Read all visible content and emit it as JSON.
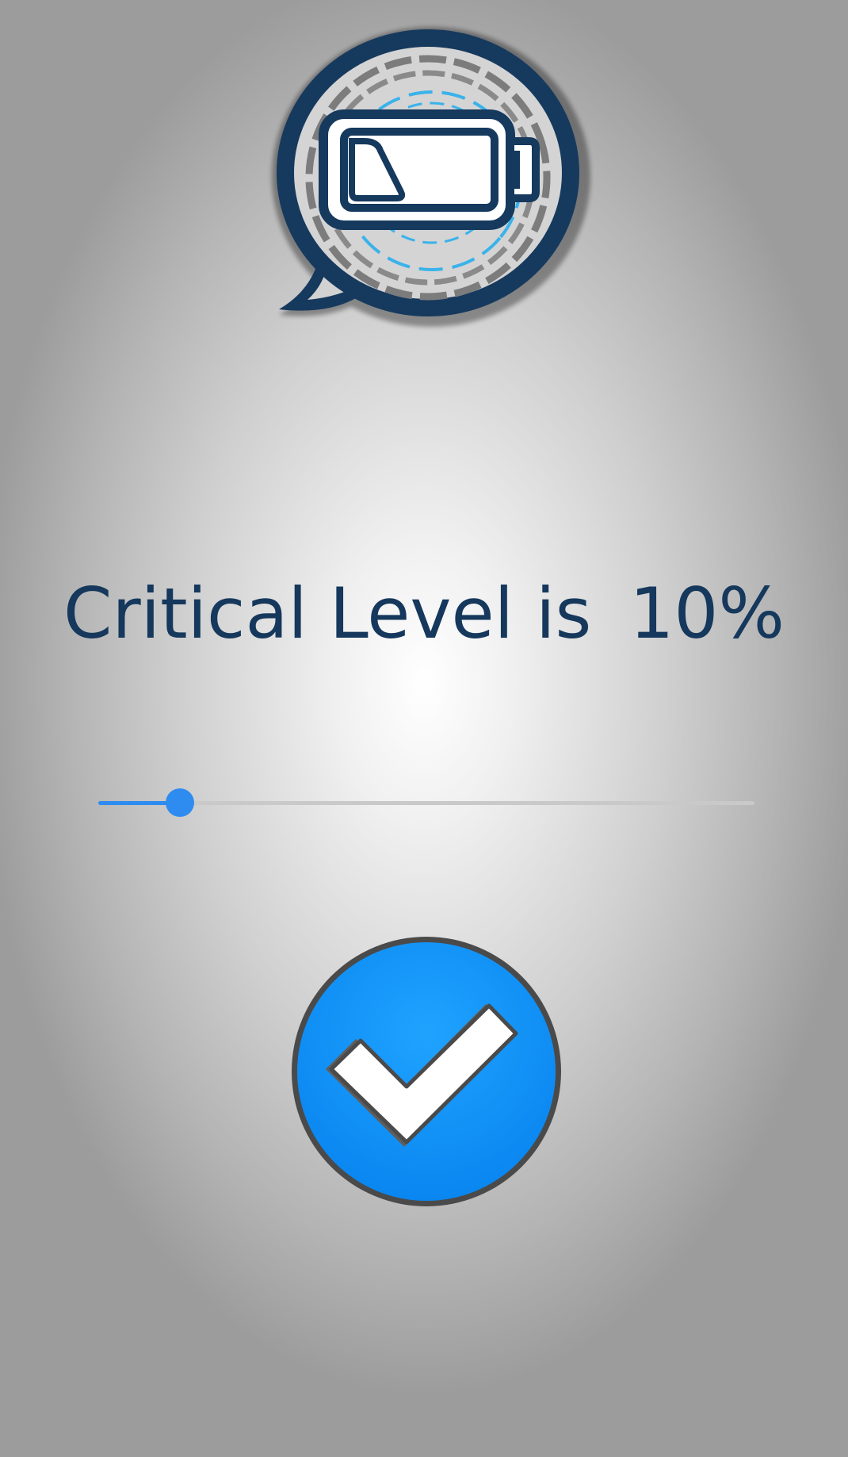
{
  "app": {
    "headline_label": "Critical Level is",
    "critical_level_display": "10%"
  },
  "slider": {
    "value_percent": 10,
    "min": 0,
    "max": 100
  },
  "icons": {
    "logo": "battery-speech-bubble-icon",
    "confirm": "checkmark-icon"
  },
  "colors": {
    "text": "#15385c",
    "accent": "#2e8cf0",
    "track": "#c9c9c9",
    "confirm_fill": "#0a8ef5",
    "logo_navy": "#16395e",
    "logo_blue": "#3ab2ea"
  }
}
